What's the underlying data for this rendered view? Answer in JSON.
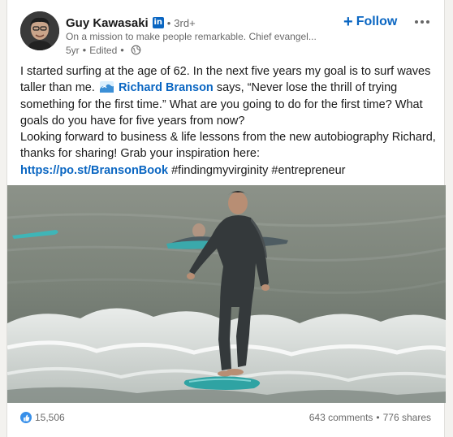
{
  "author": {
    "name": "Guy Kawasaki",
    "badge": "in",
    "degree": "3rd+",
    "headline": "On a mission to make people remarkable. Chief evangel...",
    "age": "5yr",
    "edited": "Edited"
  },
  "actions": {
    "follow_label": "Follow",
    "follow_icon": "plus-icon",
    "more_icon": "ellipsis-icon"
  },
  "post": {
    "line1": "I started surfing at the age of 62. In the next five years my goal is to surf waves taller than me.",
    "mention": "Richard Branson",
    "line1b": "says, “Never lose the thrill of trying something for the first time.” What are you going to do for the first time? What goals do you have for five years from now?",
    "line2": "Looking forward to business & life lessons from the new autobiography Richard, thanks for sharing! Grab your inspiration here:",
    "url": "https://po.st/BransonBook",
    "hashtag1": "#findingmyvirginity",
    "hashtag2": "#entrepreneur"
  },
  "social": {
    "reactions": "15,506",
    "comments": "643 comments",
    "shares": "776 shares"
  },
  "colors": {
    "accent": "#0a66c2",
    "muted": "#666666",
    "reaction": "#378fe9"
  }
}
